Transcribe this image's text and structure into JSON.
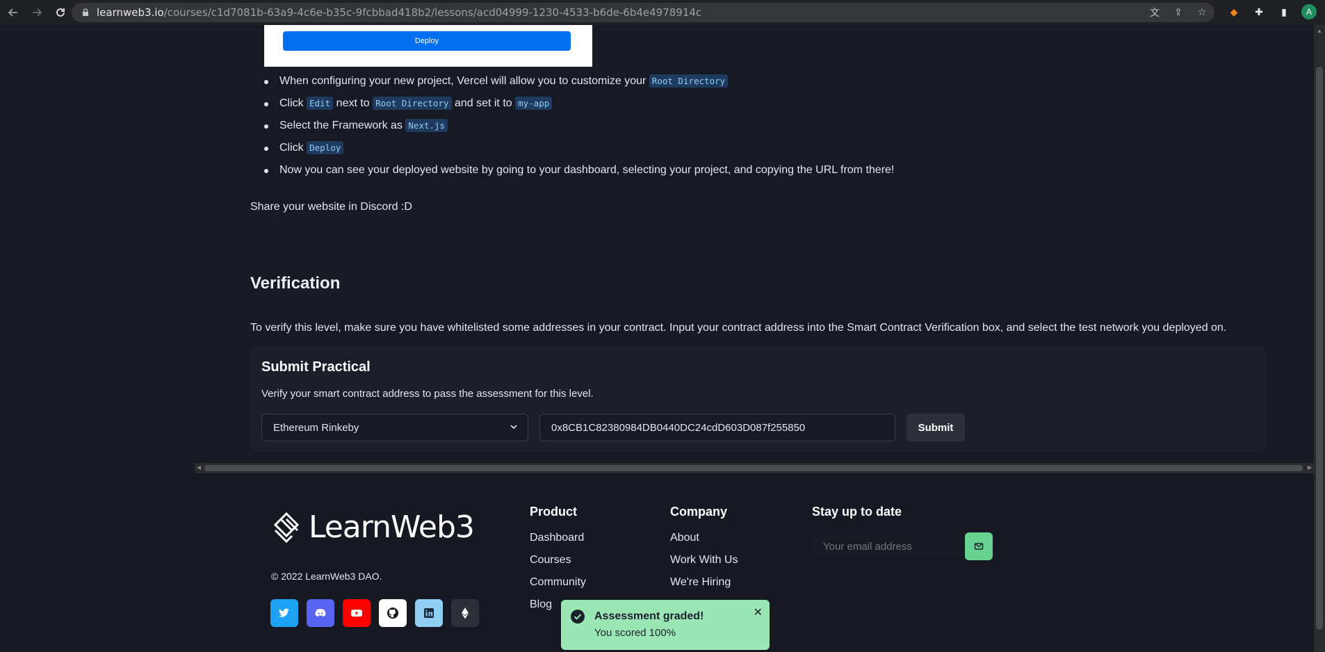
{
  "browser": {
    "url_host": "learnweb3.io",
    "url_path": "/courses/c1d7081b-63a9-4c6e-b35c-9fcbbad418b2/lessons/acd04999-1230-4533-b6de-6b4e4978914c",
    "avatar_initial": "A"
  },
  "lesson": {
    "deploy_button": "Deploy",
    "steps": [
      {
        "pre": "When configuring your new project, Vercel will allow you to customize your ",
        "code1": "Root Directory",
        "mid": "",
        "code2": "",
        "post": ""
      },
      {
        "pre": "Click ",
        "code1": "Edit",
        "mid": " next to ",
        "code2": "Root Directory",
        "post": " and set it to ",
        "code3": "my-app"
      },
      {
        "pre": "Select the Framework as ",
        "code1": "Next.js"
      },
      {
        "pre": "Click ",
        "code1": "Deploy"
      },
      {
        "pre": "Now you can see your deployed website by going to your dashboard, selecting your project, and copying the URL from there!"
      }
    ],
    "share_text": "Share your website in Discord :D",
    "verification_title": "Verification",
    "verification_text": "To verify this level, make sure you have whitelisted some addresses in your contract. Input your contract address into the Smart Contract Verification box, and select the test network you deployed on."
  },
  "practical": {
    "title": "Submit Practical",
    "description": "Verify your smart contract address to pass the assessment for this level.",
    "network_selected": "Ethereum Rinkeby",
    "contract_address": "0x8CB1C82380984DB0440DC24cdD603D087f255850",
    "submit_label": "Submit"
  },
  "footer": {
    "logo_text": "LearnWeb3",
    "copyright": "© 2022 LearnWeb3 DAO.",
    "product": {
      "title": "Product",
      "links": [
        "Dashboard",
        "Courses",
        "Community",
        "Blog"
      ]
    },
    "company": {
      "title": "Company",
      "links": [
        "About",
        "Work With Us",
        "We're Hiring"
      ]
    },
    "newsletter": {
      "title": "Stay up to date",
      "placeholder": "Your email address"
    },
    "socials": [
      {
        "name": "twitter",
        "color": "#1da1f2"
      },
      {
        "name": "discord",
        "color": "#5865f2"
      },
      {
        "name": "youtube",
        "color": "#ff0000"
      },
      {
        "name": "github",
        "color": "#ffffff"
      },
      {
        "name": "linkedin",
        "color": "#90cdf4"
      },
      {
        "name": "ethereum",
        "color": "#2d3039"
      }
    ]
  },
  "toast": {
    "title": "Assessment graded!",
    "body": "You scored 100%",
    "color": "#9ae6b4"
  }
}
